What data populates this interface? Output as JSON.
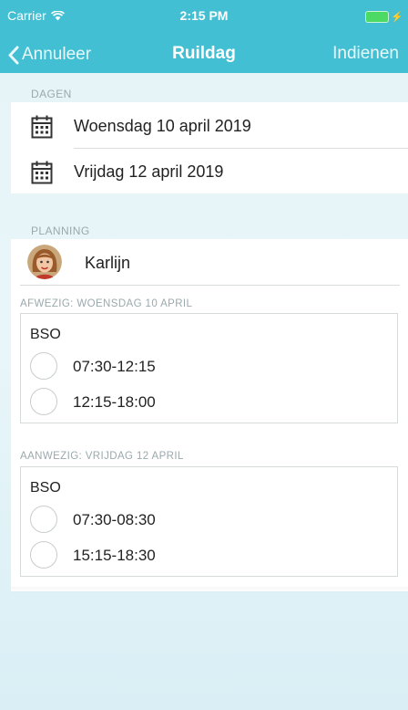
{
  "status_bar": {
    "carrier": "Carrier",
    "time": "2:15 PM"
  },
  "nav": {
    "back_label": "Annuleer",
    "title": "Ruildag",
    "submit_label": "Indienen"
  },
  "dagen": {
    "header": "DAGEN",
    "items": [
      {
        "label": "Woensdag 10 april 2019"
      },
      {
        "label": "Vrijdag 12 april 2019"
      }
    ]
  },
  "planning": {
    "header": "PLANNING",
    "child_name": "Karlijn",
    "absent": {
      "header": "AFWEZIG: WOENSDAG 10 APRIL",
      "group": "BSO",
      "slots": [
        {
          "label": "07:30-12:15"
        },
        {
          "label": "12:15-18:00"
        }
      ]
    },
    "present": {
      "header": "AANWEZIG: VRIJDAG 12 APRIL",
      "group": "BSO",
      "slots": [
        {
          "label": "07:30-08:30"
        },
        {
          "label": "15:15-18:30"
        }
      ]
    }
  },
  "colors": {
    "accent": "#43bfd3",
    "background": "#e6f4f8",
    "battery": "#4cd964"
  }
}
